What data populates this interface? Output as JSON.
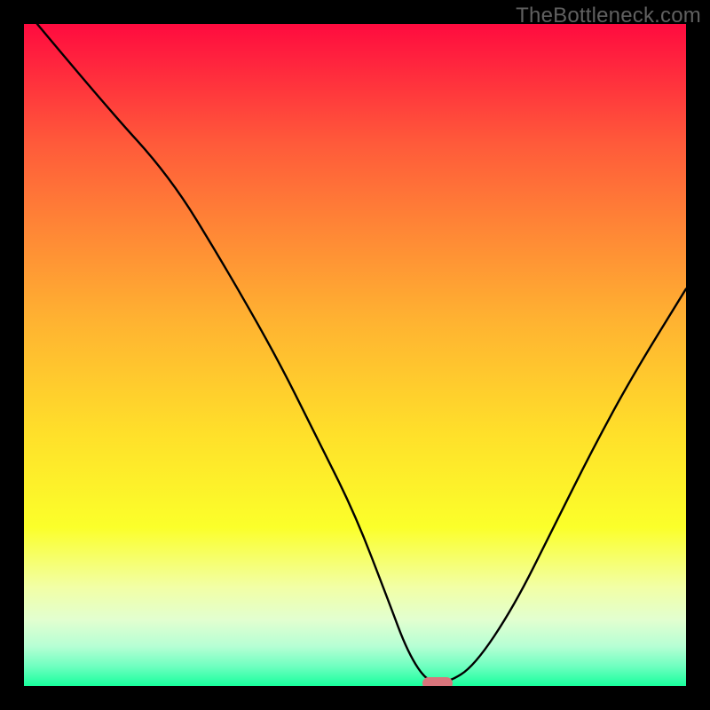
{
  "watermark": "TheBottleneck.com",
  "chart_data": {
    "type": "line",
    "title": "",
    "xlabel": "",
    "ylabel": "",
    "xlim": [
      0,
      100
    ],
    "ylim": [
      0,
      100
    ],
    "x": [
      2,
      12,
      22,
      30,
      38,
      44,
      50,
      55,
      58,
      61,
      64,
      68,
      74,
      80,
      86,
      92,
      100
    ],
    "values": [
      100,
      88,
      77,
      64,
      50,
      38,
      26,
      13,
      5,
      0.5,
      0.5,
      3,
      12,
      24,
      36,
      47,
      60
    ],
    "marker": {
      "x": 62.5,
      "y": 0.4
    },
    "gradient_stops": [
      {
        "pos": 0,
        "color": "#ff0b3f"
      },
      {
        "pos": 8,
        "color": "#ff2e3d"
      },
      {
        "pos": 18,
        "color": "#ff5a3a"
      },
      {
        "pos": 30,
        "color": "#ff8336"
      },
      {
        "pos": 45,
        "color": "#ffb331"
      },
      {
        "pos": 62,
        "color": "#ffe02a"
      },
      {
        "pos": 76,
        "color": "#fbff2a"
      },
      {
        "pos": 85,
        "color": "#f2ffa5"
      },
      {
        "pos": 90,
        "color": "#e2ffd0"
      },
      {
        "pos": 94,
        "color": "#b6ffd4"
      },
      {
        "pos": 97,
        "color": "#6fffc0"
      },
      {
        "pos": 100,
        "color": "#18ff9d"
      }
    ]
  }
}
